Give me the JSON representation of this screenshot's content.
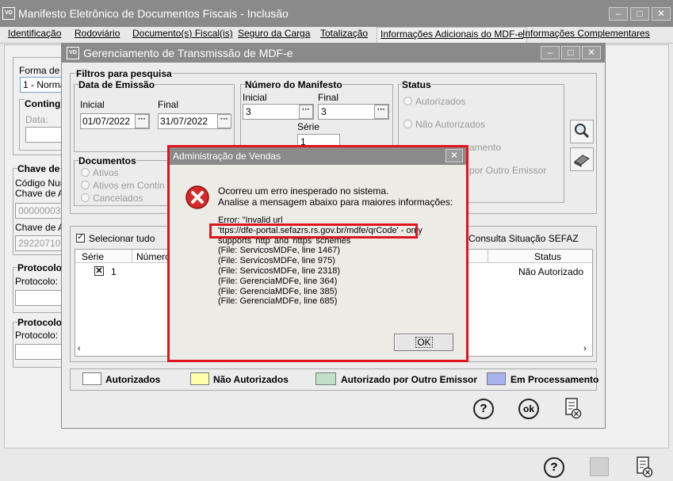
{
  "main_window": {
    "title": "Manifesto Eletrônico de Documentos Fiscais - Inclusão",
    "icon": "VD",
    "tabs": [
      "Identificação",
      "Rodoviário",
      "Documento(s) Fiscal(is)",
      "Seguro da Carga",
      "Totalização",
      "Informações Adicionais do MDF-e",
      "Informações Complementares"
    ],
    "forma_label": "Forma de E",
    "forma_value": "1 - Norma",
    "contingencia_label": "Conting",
    "data_label": "Data:",
    "chave_label": "Chave de",
    "codigo_label": "Código Num",
    "chave_a_label": "Chave de A",
    "codigo_value": "00000003",
    "chave_a2_label": "Chave de A",
    "chave_value": "292207109",
    "protocolo1_group": "Protocolo",
    "protocolo1_label": "Protocolo:",
    "protocolo2_group": "Protocolo",
    "protocolo2_label": "Protocolo:"
  },
  "transmissao_window": {
    "title": "Gerenciamento de Transmissão de MDF-e",
    "icon": "VD",
    "filtros_label": "Filtros para pesquisa",
    "data_emissao_label": "Data de Emissão",
    "inicial_label": "Inicial",
    "final_label": "Final",
    "data_inicial": "01/07/2022",
    "data_final": "31/07/2022",
    "numero_manifesto_label": "Número do Manifesto",
    "num_inicial_label": "Inicial",
    "num_final_label": "Final",
    "num_inicial": "3",
    "num_final": "3",
    "serie_label": "Série",
    "serie_value": "1",
    "status_label": "Status",
    "status_options": [
      "Autorizados",
      "Não Autorizados",
      "Em Processamento",
      "Autorizado por Outro Emissor"
    ],
    "status_options_visible": [
      "Autorizados",
      "Não Autorizados",
      "amento",
      "por Outro Emissor"
    ],
    "documentos_label": "Documentos",
    "documentos_options": [
      "Ativos",
      "Ativos em Contin",
      "Cancelados"
    ],
    "selecionar_tudo": "Selecionar tudo",
    "consulta_label": "Consulta Situação SEFAZ",
    "table_headers": [
      "Série",
      "Número",
      "Status"
    ],
    "rows": [
      {
        "serie": "1",
        "status": "Não Autorizado",
        "checked": true
      }
    ],
    "legend": [
      "Autorizados",
      "Não Autorizados",
      "Autorizado por Outro Emissor",
      "Em Processamento"
    ],
    "legend_colors": [
      "#ffffff",
      "#ffffaa",
      "#c2dfc8",
      "#aab2ee"
    ]
  },
  "dialog": {
    "title": "Administração de Vendas",
    "message_line1": "Ocorreu um erro inesperado no sistema.",
    "message_line2": "Analise a mensagem abaixo para maiores informações:",
    "error_line1": "Error: \"Invalid url",
    "error_url": "'ttps://dfe-portal.sefazrs.rs.gov.br/mdfe/qrCode'",
    "error_line2_rest": " - only",
    "error_line3": "supports 'http' and 'https' schemes",
    "stack": [
      "(File: ServicosMDFe, line 1467)",
      "(File: ServicosMDFe, line 975)",
      "(File: ServicosMDFe, line 2318)",
      "(File: GerenciaMDFe, line 364)",
      "(File: GerenciaMDFe, line 385)",
      "(File: GerenciaMDFe, line 685)"
    ],
    "ok_label": "OK",
    "highlight_color": "#e0141e"
  }
}
